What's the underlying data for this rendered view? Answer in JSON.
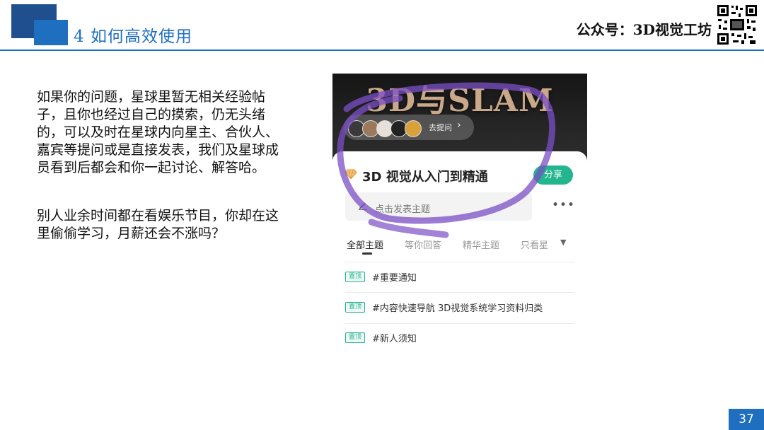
{
  "header": {
    "title": "4 如何高效使用",
    "brand": "公众号：3D视觉工坊"
  },
  "content": {
    "paragraph1": "如果你的问题，星球里暂无相关经验帖子，且你也经过自己的摸索，仍无头绪的，可以及时在星球内向星主、合伙人、嘉宾等提问或是直接发表，我们及星球成员看到后都会和你一起讨论、解答哈。",
    "paragraph2": "别人业余时间都在看娱乐节目，你却在这里偷偷学习，月薪还会不涨吗？"
  },
  "screenshot": {
    "banner_title": "3D与SLAM",
    "ask_label": "去提问",
    "ask_chevron": "›",
    "group_name": "3D 视觉从入门到精通",
    "share_label": "分享",
    "post_placeholder": "点击发表主题",
    "more_icon": "•••",
    "tabs": [
      "全部主题",
      "等你回答",
      "精华主题",
      "只看星"
    ],
    "tab_caret": "▼",
    "pinned_badge": "置顶",
    "pinned": [
      "#重要通知",
      "#内容快速导航 3D视觉系统学习资料归类",
      "#新人须知"
    ],
    "icons": {
      "diamond": "diamond-icon",
      "pencil": "pencil-icon",
      "caret": "caret-down-icon"
    }
  },
  "page_number": "37",
  "colors": {
    "accent": "#1f6fc0",
    "dark_accent": "#1f4f8e",
    "share_green": "#23b58d",
    "scribble": "#7a4fc4"
  }
}
